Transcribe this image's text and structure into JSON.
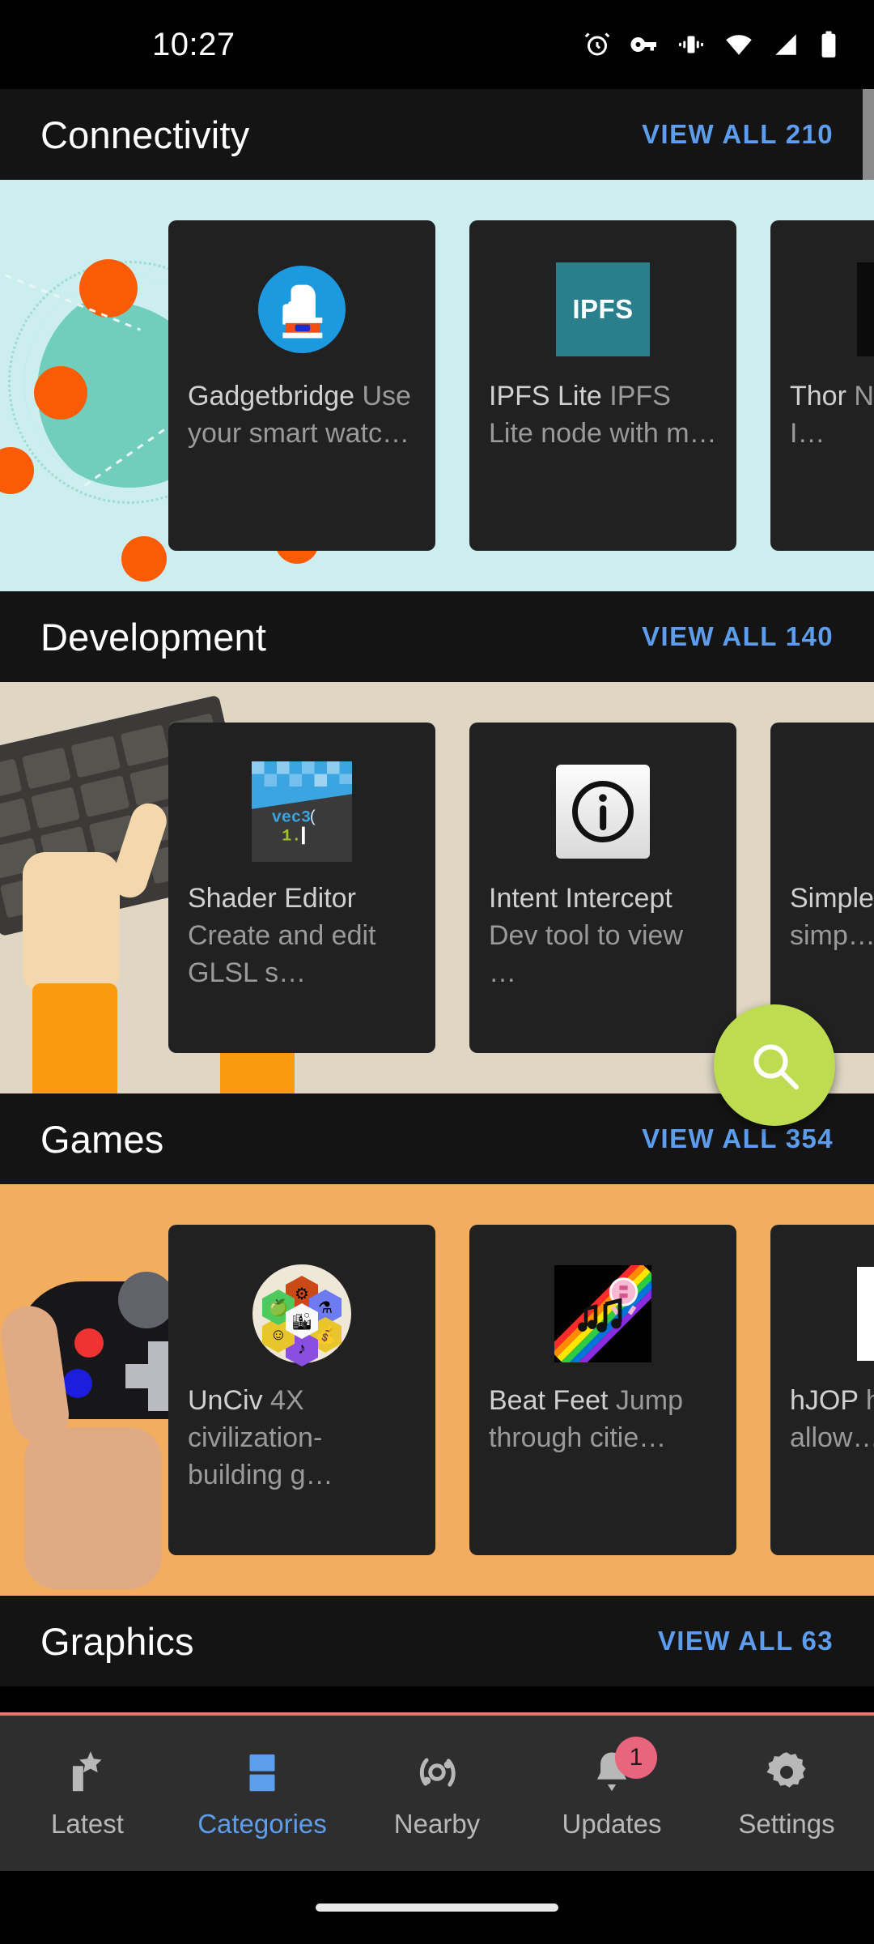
{
  "status_bar": {
    "time": "10:27",
    "icons": [
      "alarm-icon",
      "vpn-key-icon",
      "vibrate-icon",
      "wifi-icon",
      "cell-signal-icon",
      "battery-icon"
    ]
  },
  "theme": {
    "accent_blue": "#5c9ded",
    "card_bg": "#212121",
    "header_bg": "#141414",
    "fab_green": "#bedc4f",
    "badge_red": "#e8657d",
    "nav_bg": "#2e2e2e"
  },
  "sections": [
    {
      "title": "Connectivity",
      "view_all": "VIEW ALL 210",
      "banner": "globe-network-illustration",
      "banner_color": "#cdeeee",
      "apps": [
        {
          "name": "Gadgetbridge",
          "desc": "Use your smart watc…",
          "icon": "gadgetbridge-icon"
        },
        {
          "name": "IPFS Lite",
          "desc": "IPFS Lite node with m…",
          "icon": "ipfs-icon",
          "icon_label": "IPFS"
        },
        {
          "name": "Thor",
          "desc": "Nativ… and I…",
          "icon": "thor-icon"
        }
      ]
    },
    {
      "title": "Development",
      "view_all": "VIEW ALL 140",
      "banner": "keyboard-typing-illustration",
      "banner_color": "#dfd6c3",
      "apps": [
        {
          "name": "Shader Editor",
          "desc": "Create and edit GLSL s…",
          "icon": "shader-editor-icon",
          "icon_code1": "vec3(",
          "icon_code2": "1."
        },
        {
          "name": "Intent Intercept",
          "desc": "Dev tool to view …",
          "icon": "info-circle-icon"
        },
        {
          "name": "Simple Editor",
          "desc": "simp…",
          "icon": "android-robot-icon"
        }
      ]
    },
    {
      "title": "Games",
      "view_all": "VIEW ALL 354",
      "banner": "gamepad-illustration",
      "banner_color": "#f2ad5e",
      "apps": [
        {
          "name": "UnCiv",
          "desc": "4X civilization-building g…",
          "icon": "unciv-hex-icon"
        },
        {
          "name": "Beat Feet",
          "desc": "Jump through citie…",
          "icon": "beat-feet-icon"
        },
        {
          "name": "hJOP",
          "desc": "hJOP allow…",
          "icon": "hjop-icon"
        }
      ]
    },
    {
      "title": "Graphics",
      "view_all": "VIEW ALL 63",
      "banner": "",
      "banner_color": "",
      "apps": []
    }
  ],
  "fab": {
    "icon": "search-icon",
    "label": "Search"
  },
  "bottom_nav": {
    "items": [
      {
        "label": "Latest",
        "icon": "star-new-icon",
        "active": false,
        "badge": ""
      },
      {
        "label": "Categories",
        "icon": "categories-icon",
        "active": true,
        "badge": ""
      },
      {
        "label": "Nearby",
        "icon": "nearby-icon",
        "active": false,
        "badge": ""
      },
      {
        "label": "Updates",
        "icon": "bell-icon",
        "active": false,
        "badge": "1"
      },
      {
        "label": "Settings",
        "icon": "gear-icon",
        "active": false,
        "badge": ""
      }
    ]
  }
}
